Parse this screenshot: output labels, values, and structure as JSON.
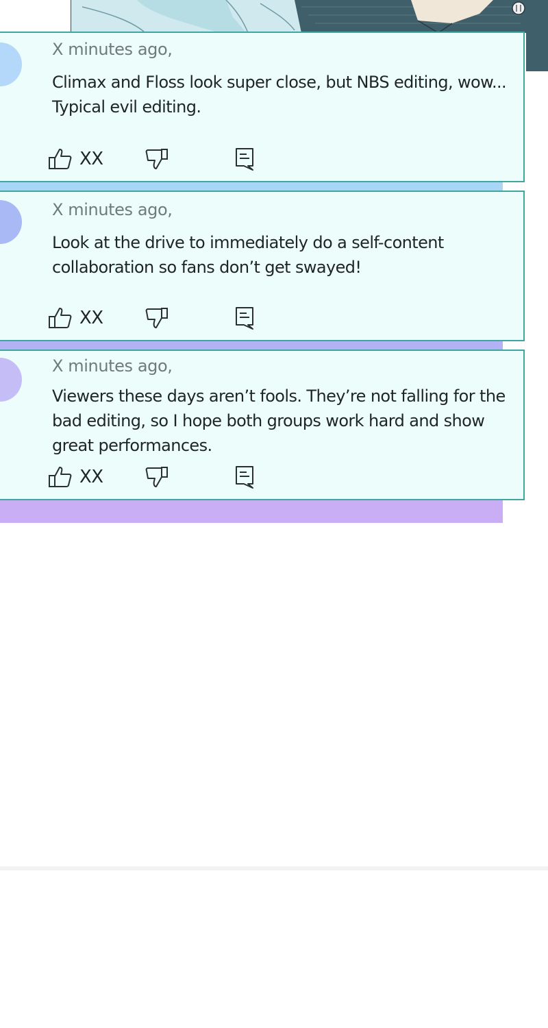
{
  "comments": [
    {
      "timestamp": "X minutes ago,",
      "text": "Climax and Floss look super close, but NBS editing, wow... Typical evil editing.",
      "likes": "XX",
      "avatar_color": "#b3d8fa",
      "shadow_color": "#aad6f6"
    },
    {
      "timestamp": "X minutes ago,",
      "text": "Look at the drive to immediately do a self-content collaboration so fans don’t get swayed!",
      "likes": "XX",
      "avatar_color": "#a9b9f5",
      "shadow_color": "#b3b2f4"
    },
    {
      "timestamp": "X minutes ago,",
      "text": "Viewers these days aren’t fools. They’re not falling for the bad editing, so I hope both groups work hard and show great performances.",
      "likes": "XX",
      "avatar_color": "#c5bdf6",
      "shadow_color": "#c9adf5"
    }
  ],
  "colors": {
    "card_background": "#ecfdfb",
    "card_border": "#3fa7a0",
    "icon_stroke": "#2a2f30"
  },
  "icons": {
    "like": "thumbs-up-icon",
    "dislike": "thumbs-down-icon",
    "reply": "comment-icon"
  }
}
